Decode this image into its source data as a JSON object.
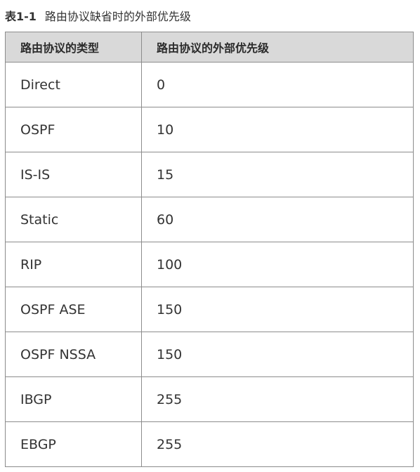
{
  "caption": {
    "label": "表1-1",
    "title": "路由协议缺省时的外部优先级"
  },
  "table": {
    "headers": [
      "路由协议的类型",
      "路由协议的外部优先级"
    ],
    "rows": [
      {
        "protocol": "Direct",
        "preference": "0"
      },
      {
        "protocol": "OSPF",
        "preference": "10"
      },
      {
        "protocol": "IS-IS",
        "preference": "15"
      },
      {
        "protocol": "Static",
        "preference": "60"
      },
      {
        "protocol": "RIP",
        "preference": "100"
      },
      {
        "protocol": "OSPF ASE",
        "preference": "150"
      },
      {
        "protocol": "OSPF NSSA",
        "preference": "150"
      },
      {
        "protocol": "IBGP",
        "preference": "255"
      },
      {
        "protocol": "EBGP",
        "preference": "255"
      }
    ]
  },
  "colors": {
    "header_background": "#d9d9d9",
    "border": "#8c8c8c",
    "text": "#333333"
  }
}
